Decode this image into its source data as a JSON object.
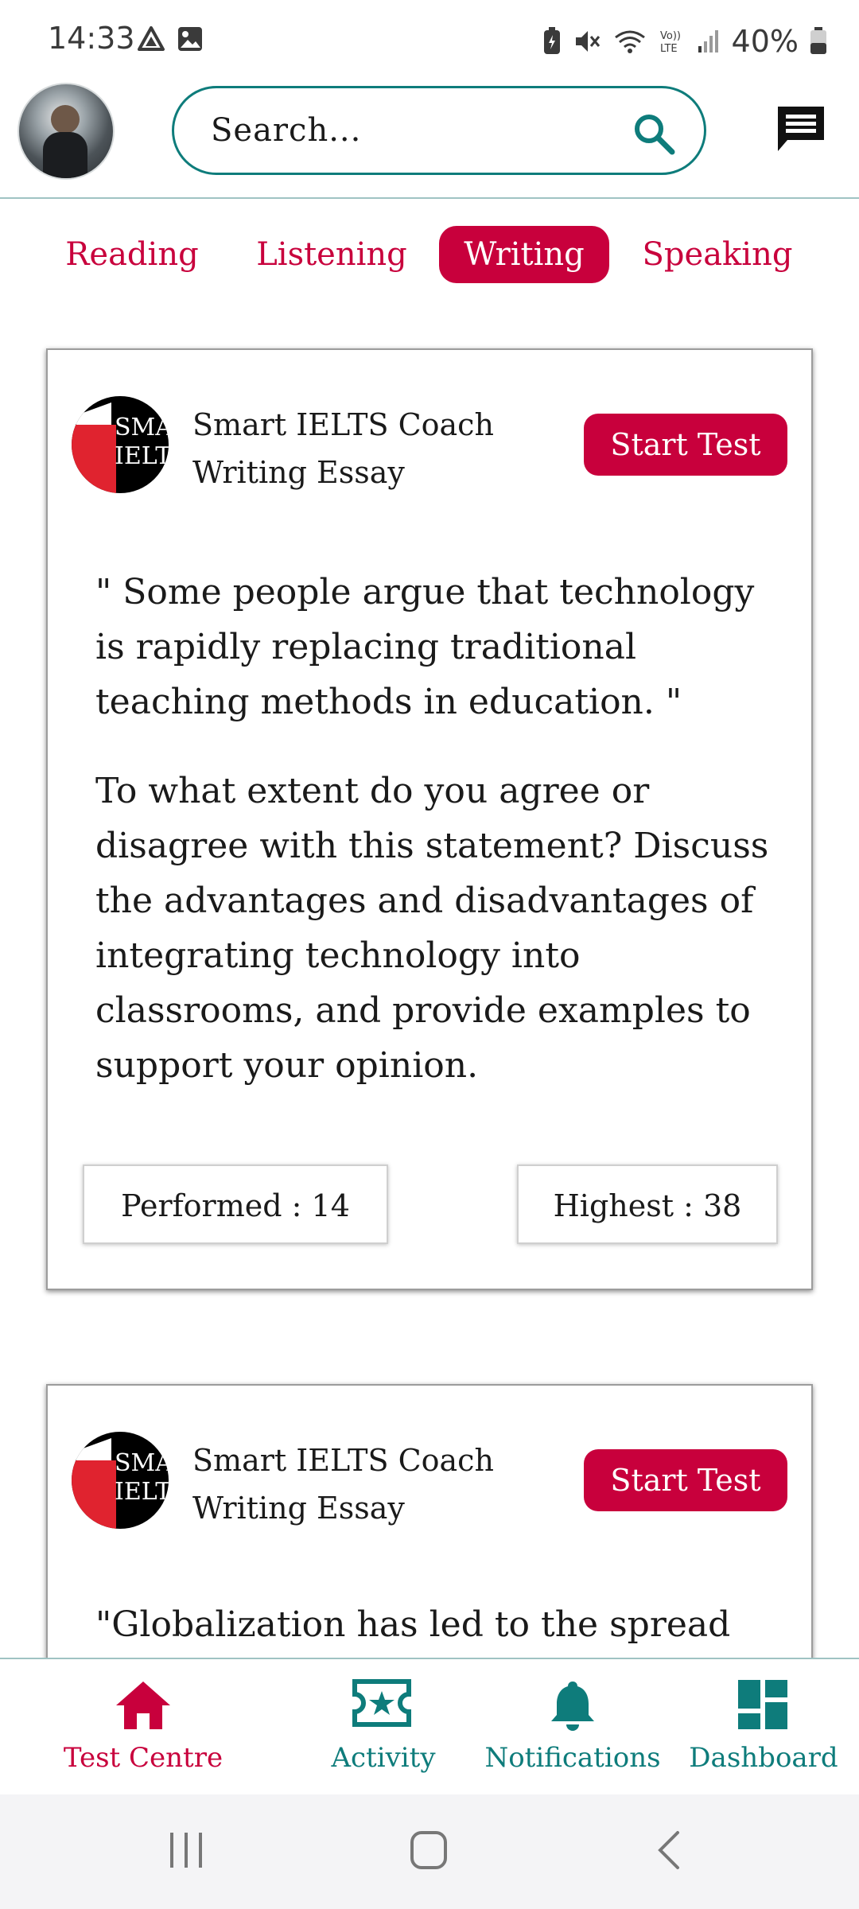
{
  "status_bar": {
    "time": "14:33",
    "battery": "40%"
  },
  "header": {
    "search_placeholder": "Search..."
  },
  "tabs": [
    {
      "label": "Reading",
      "active": false
    },
    {
      "label": "Listening",
      "active": false
    },
    {
      "label": "Writing",
      "active": true
    },
    {
      "label": "Speaking",
      "active": false
    }
  ],
  "cards": [
    {
      "title_line1": "Smart IELTS Coach",
      "title_line2": "Writing Essay",
      "logo_text_1": "SMA",
      "logo_text_2": "IELT",
      "start_label": "Start Test",
      "quote": " \" Some people argue that technology is rapidly replacing traditional teaching methods in education. \"",
      "question": "To what extent do you agree or disagree with this statement? Discuss the advantages and disadvantages of integrating technology into classrooms, and provide examples to support your opinion.",
      "performed": "Performed : 14",
      "highest": "Highest : 38"
    },
    {
      "title_line1": "Smart IELTS Coach",
      "title_line2": "Writing Essay",
      "logo_text_1": "SMA",
      "logo_text_2": "IELT",
      "start_label": "Start Test",
      "quote": " \"Globalization has led to the spread"
    }
  ],
  "bottom_nav": [
    {
      "label": "Test Centre",
      "icon": "home-icon",
      "active": true
    },
    {
      "label": "Activity",
      "icon": "ticket-star-icon",
      "active": false
    },
    {
      "label": "Notifications",
      "icon": "bell-icon",
      "active": false
    },
    {
      "label": "Dashboard",
      "icon": "dashboard-icon",
      "active": false
    }
  ],
  "colors": {
    "accent": "#c8003c",
    "teal": "#0e7c7b"
  }
}
